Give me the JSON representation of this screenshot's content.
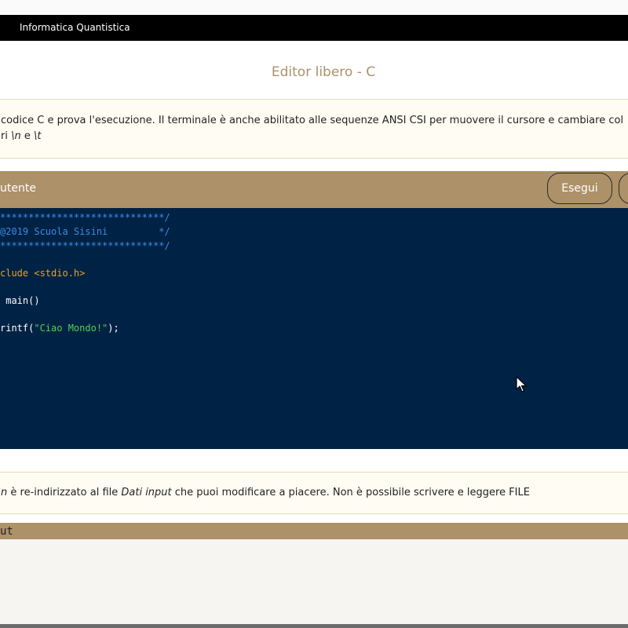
{
  "navbar": {
    "brand": "Informatica Quantistica"
  },
  "page_title": "Editor libero - C",
  "intro": {
    "line1": "codice C e prova l'esecuzione. Il terminale è anche abilitato alle sequenze ANSI CSI per muovere il cursore e cambiare col",
    "line2_prefix": "ri ",
    "line2_code1": "\\n",
    "line2_mid": " e ",
    "line2_code2": "\\t"
  },
  "editor": {
    "header_label": "utente",
    "run_label": "Esegui",
    "code_lines": [
      {
        "text": "*****************************/",
        "kind": "comment"
      },
      {
        "text": "@2019 Scuola Sisini         */",
        "kind": "comment"
      },
      {
        "text": "*****************************/",
        "kind": "comment"
      },
      {
        "text": "",
        "kind": "plain"
      },
      {
        "text": "clude <stdio.h>",
        "kind": "directive"
      },
      {
        "text": "",
        "kind": "plain"
      },
      {
        "text": " main()",
        "kind": "plain"
      },
      {
        "text": "",
        "kind": "plain"
      },
      {
        "text_before": "rintf(",
        "string": "\"Ciao Mondo!\"",
        "text_after": ");",
        "kind": "mixed"
      }
    ]
  },
  "stdin_note": {
    "prefix": "n",
    "text1": " è re-indirizzato al file ",
    "italic": "Dati input",
    "text2": " che puoi modificare a piacere. Non è possibile scrivere e leggere FILE"
  },
  "output": {
    "header_label": "ut"
  },
  "colors": {
    "accent": "#ad9168",
    "editor_bg": "#002244",
    "navbar_bg": "#000000",
    "comment": "#3d8be6",
    "directive": "#e6a02a",
    "string": "#4fd04f"
  }
}
